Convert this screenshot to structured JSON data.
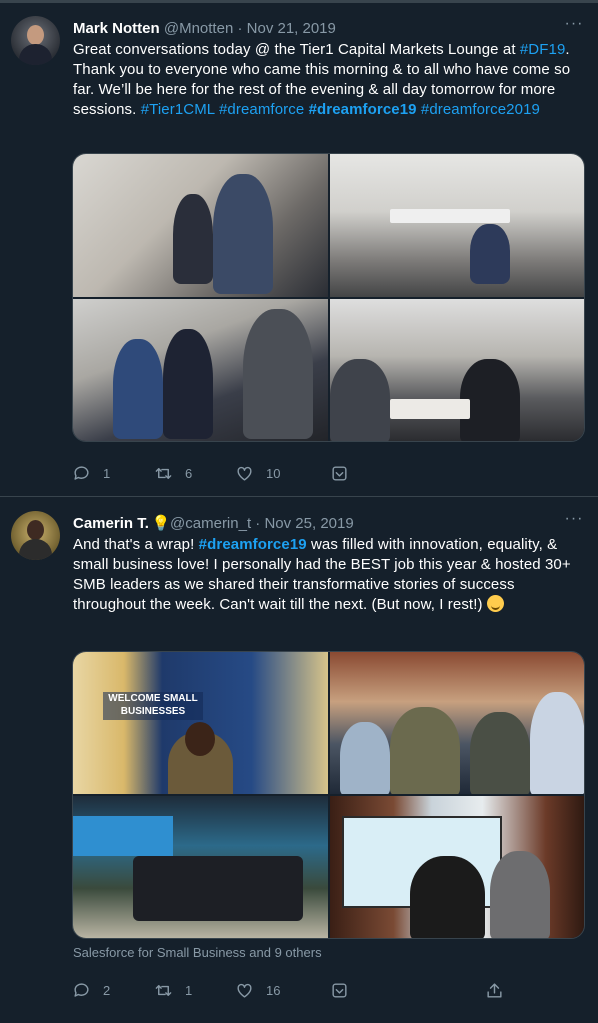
{
  "tweets": [
    {
      "name": "Mark Notten",
      "handle": "@Mnotten",
      "separator": " · ",
      "date": "Nov 21, 2019",
      "text_parts": [
        {
          "type": "text",
          "value": "Great conversations today @ the Tier1 Capital Markets Lounge at "
        },
        {
          "type": "link",
          "value": "#DF19"
        },
        {
          "type": "text",
          "value": ". Thank you to everyone who came this morning & to all who have come so far. We’ll be here for the rest of the evening & all day tomorrow for more sessions. "
        },
        {
          "type": "link",
          "value": "#Tier1CML"
        },
        {
          "type": "text",
          "value": " "
        },
        {
          "type": "link",
          "value": "#dreamforce"
        },
        {
          "type": "text",
          "value": " "
        },
        {
          "type": "boldlink",
          "value": "#dreamforce19"
        },
        {
          "type": "text",
          "value": " "
        },
        {
          "type": "link",
          "value": "#dreamforce2019"
        }
      ],
      "more_label": "···",
      "stats": {
        "replies": "1",
        "retweets": "6",
        "likes": "10"
      }
    },
    {
      "name": "Camerin T.",
      "handle": "@camerin_t",
      "separator": " · ",
      "date": "Nov 25, 2019",
      "text_parts": [
        {
          "type": "text",
          "value": "And that's a wrap! "
        },
        {
          "type": "boldlink",
          "value": "#dreamforce19"
        },
        {
          "type": "text",
          "value": " was filled with innovation, equality, & small business love! I personally had the BEST job this year & hosted 30+ SMB leaders as we shared their transformative stories of success throughout the week. Can't wait till the next. (But now, I rest!) "
        }
      ],
      "more_label": "···",
      "sign_text": "WELCOME SMALL BUSINESSES",
      "attribution": "Salesforce for Small Business and 9 others",
      "stats": {
        "replies": "2",
        "retweets": "1",
        "likes": "16"
      }
    }
  ],
  "icons": {
    "reply": "reply-icon",
    "retweet": "retweet-icon",
    "like": "heart-icon",
    "share": "share-icon",
    "more": "more-icon",
    "bulb": "lightbulb-icon",
    "emoji": "grinning-sweat-emoji"
  },
  "colors": {
    "background": "#15202b",
    "text": "#ffffff",
    "secondary": "#8899a6",
    "link": "#1da1f2",
    "divider": "#38444d"
  }
}
